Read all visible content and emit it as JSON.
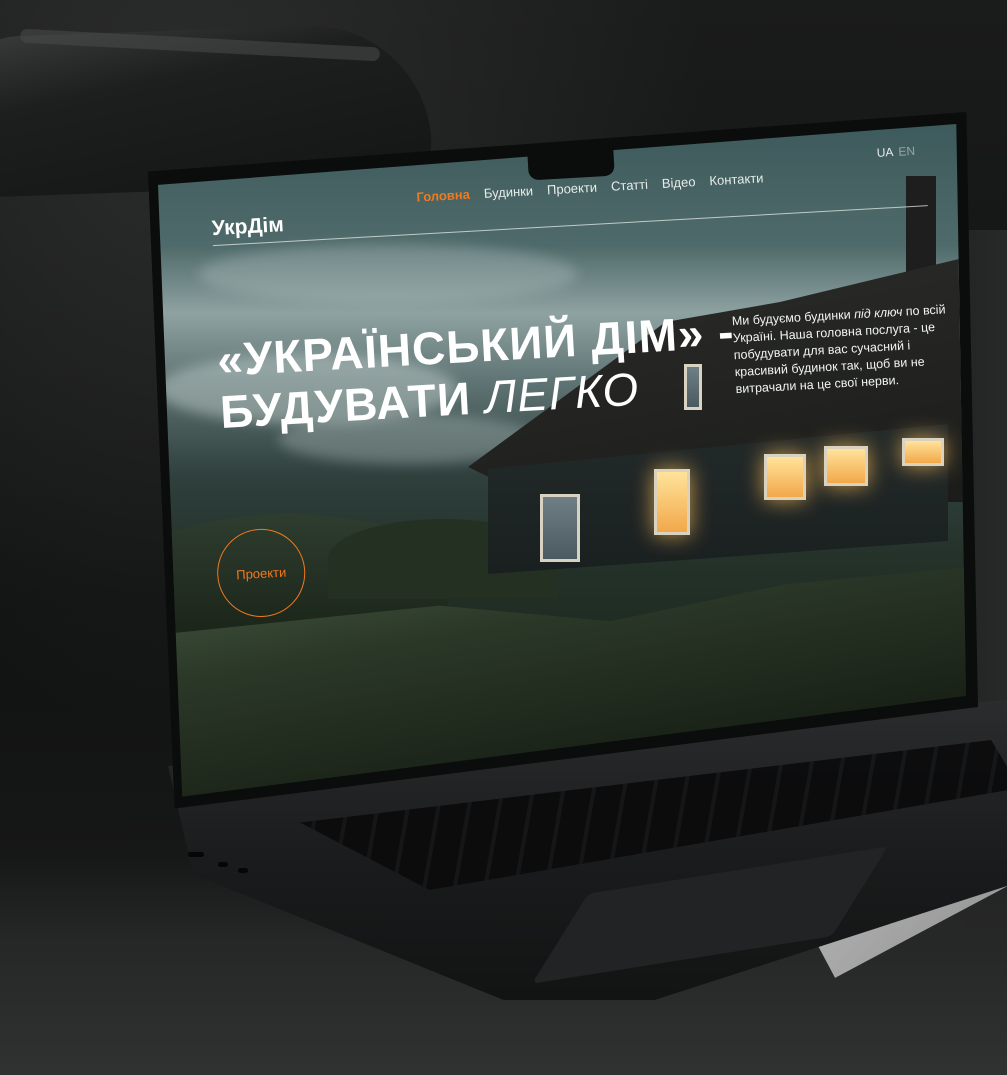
{
  "site": {
    "logo": "УкрДім",
    "nav": [
      {
        "label": "Головна",
        "active": true
      },
      {
        "label": "Будинки",
        "active": false
      },
      {
        "label": "Проекти",
        "active": false
      },
      {
        "label": "Статті",
        "active": false
      },
      {
        "label": "Відео",
        "active": false
      },
      {
        "label": "Контакти",
        "active": false
      }
    ],
    "languages": [
      "UA",
      "EN"
    ]
  },
  "hero": {
    "title_line1": "«УКРАЇНСЬКИЙ ДІМ» -",
    "title_line2_a": "БУДУВАТИ",
    "title_line2_b": "ЛЕГКО",
    "description_a": "Ми будуємо будинки",
    "description_em": "під ключ",
    "description_b": "по всій Україні. Наша головна послуга - це побудувати для вас сучасний і красивий будинок так, щоб ви не витрачали на це свої нерви.",
    "cta_label": "Проекти"
  },
  "colors": {
    "accent": "#f07a1e",
    "text": "#ffffff"
  }
}
